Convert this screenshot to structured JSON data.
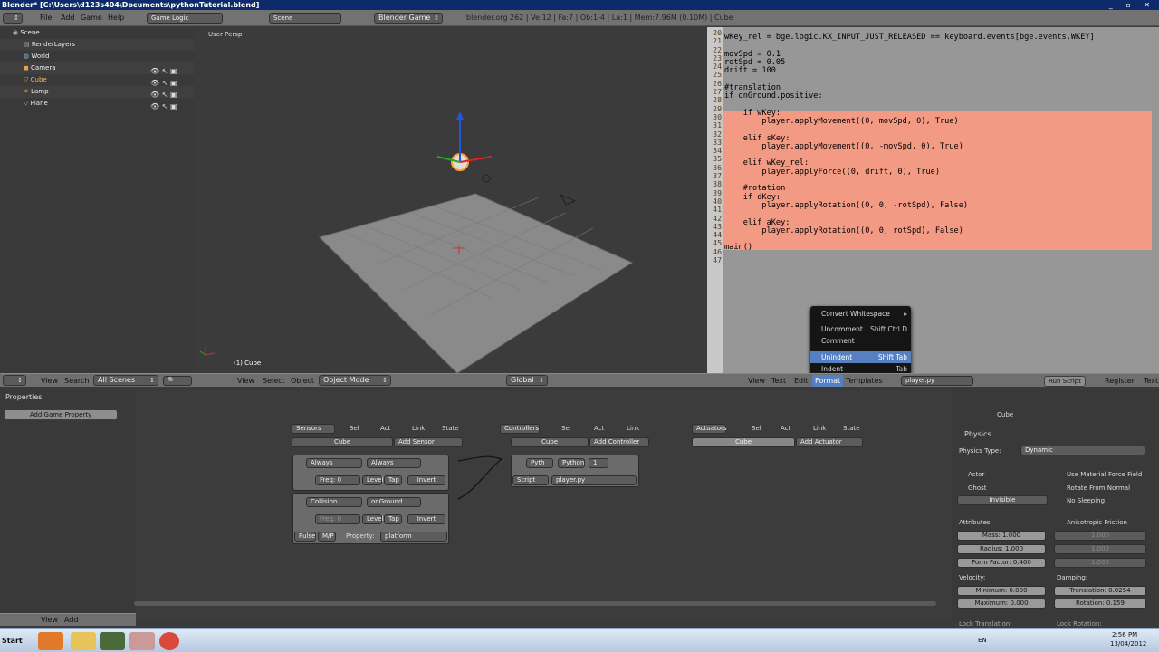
{
  "window": {
    "title": "Blender* [C:\\Users\\d123s404\\Documents\\pythonTutorial.blend]"
  },
  "infobar": {
    "menus": [
      "File",
      "Add",
      "Game",
      "Help"
    ],
    "layout": "Game Logic",
    "scene": "Scene",
    "engine": "Blender Game",
    "stats": "blender.org 262 | Ve:12 | Fa:7 | Ob:1-4 | La:1 | Mem:7.96M (0.10M) | Cube"
  },
  "outliner": {
    "items": [
      {
        "label": "Scene",
        "icon": "scene-icon"
      },
      {
        "label": "RenderLayers",
        "icon": "renderlayers-icon"
      },
      {
        "label": "World",
        "icon": "world-icon"
      },
      {
        "label": "Camera",
        "icon": "camera-icon"
      },
      {
        "label": "Cube",
        "icon": "mesh-icon"
      },
      {
        "label": "Lamp",
        "icon": "lamp-icon"
      },
      {
        "label": "Plane",
        "icon": "mesh-icon"
      }
    ],
    "footer": {
      "view": "View",
      "search": "Search",
      "filter": "All Scenes"
    }
  },
  "viewport": {
    "label": "User Persp",
    "object": "(1) Cube",
    "footer": {
      "view": "View",
      "select": "Select",
      "object": "Object",
      "mode": "Object Mode",
      "orientation": "Global"
    }
  },
  "text_editor": {
    "line_numbers": "20\n21\n22\n23\n24\n25\n26\n27\n28\n29\n30\n31\n32\n33\n34\n35\n36\n37\n38\n39\n40\n41\n42\n43\n44\n45\n46\n47",
    "code": "wKey_rel = bge.logic.KX_INPUT_JUST_RELEASED == keyboard.events[bge.events.WKEY]\n\nmovSpd = 0.1\nrotSpd = 0.05\ndrift = 100\n\n#translation\nif onGround.positive:\n\n    if wKey:\n        player.applyMovement((0, movSpd, 0), True)\n\n    elif sKey:\n        player.applyMovement((0, -movSpd, 0), True)\n\n    elif wKey_rel:\n        player.applyForce((0, drift, 0), True)\n\n    #rotation\n    if dKey:\n        player.applyRotation((0, 0, -rotSpd), False)\n\n    elif aKey:\n        player.applyRotation((0, 0, rotSpd), False)\n\nmain()",
    "footer": {
      "view": "View",
      "text": "Text",
      "edit": "Edit",
      "format": "Format",
      "templates": "Templates",
      "file": "player.py",
      "run": "Run Script",
      "register": "Register",
      "toggle": "Text"
    }
  },
  "format_menu": {
    "items": [
      {
        "label": "Convert Whitespace",
        "shortcut": "▸"
      },
      {
        "label": "Uncomment",
        "shortcut": "Shift Ctrl D"
      },
      {
        "label": "Comment",
        "shortcut": ""
      },
      {
        "label": "Unindent",
        "shortcut": "Shift Tab"
      },
      {
        "label": "Indent",
        "shortcut": "Tab"
      }
    ]
  },
  "properties_left": {
    "header": "Properties",
    "add_button": "Add Game Property"
  },
  "logic": {
    "sensors": {
      "title": "Sensors",
      "sel": "Sel",
      "act": "Act",
      "link": "Link",
      "state": "State",
      "object": "Cube",
      "add": "Add Sensor"
    },
    "controllers": {
      "title": "Controllers",
      "sel": "Sel",
      "act": "Act",
      "link": "Link",
      "object": "Cube",
      "add": "Add Controller"
    },
    "actuators": {
      "title": "Actuators",
      "sel": "Sel",
      "act": "Act",
      "link": "Link",
      "state": "State",
      "object": "Cube",
      "add": "Add Actuator"
    },
    "sensor1": {
      "type": "Always",
      "name": "Always",
      "freq": "Freq: 0",
      "level": "Level",
      "tap": "Tap",
      "invert": "Invert"
    },
    "sensor2": {
      "type": "Collision",
      "name": "onGround",
      "freq": "Freq: 0",
      "level": "Level",
      "tap": "Tap",
      "invert": "Invert",
      "pulse": "Pulse",
      "mp": "M/P",
      "property_label": "Property:",
      "property": "platform"
    },
    "controller1": {
      "short": "Pyth",
      "type": "Python",
      "num": "1",
      "mode": "Script",
      "script": "player.py"
    },
    "footer": {
      "view": "View",
      "add": "Add"
    }
  },
  "physics": {
    "object": "Cube",
    "section": "Physics",
    "type_label": "Physics Type:",
    "type": "Dynamic",
    "actor": "Actor",
    "ghost": "Ghost",
    "invisible": "Invisible",
    "use_material": "Use Material Force Field",
    "rotate_normal": "Rotate From Normal",
    "no_sleeping": "No Sleeping",
    "attributes": "Attributes:",
    "mass": "Mass: 1.000",
    "radius": "Radius: 1.000",
    "form": "Form Factor: 0.400",
    "aniso": "Anisotropic Friction",
    "aniso_vals": [
      "1.000",
      "1.000",
      "1.000"
    ],
    "velocity": "Velocity:",
    "min": "Minimum: 0.000",
    "max": "Maximum: 0.000",
    "damping": "Damping:",
    "translation": "Translation: 0.0254",
    "rotation": "Rotation: 0.159",
    "lock_translation": "Lock Translation:",
    "lock_rotation": "Lock Rotation:"
  },
  "taskbar": {
    "start": "Start",
    "lang": "EN",
    "time": "2:56 PM",
    "date": "13/04/2012"
  }
}
